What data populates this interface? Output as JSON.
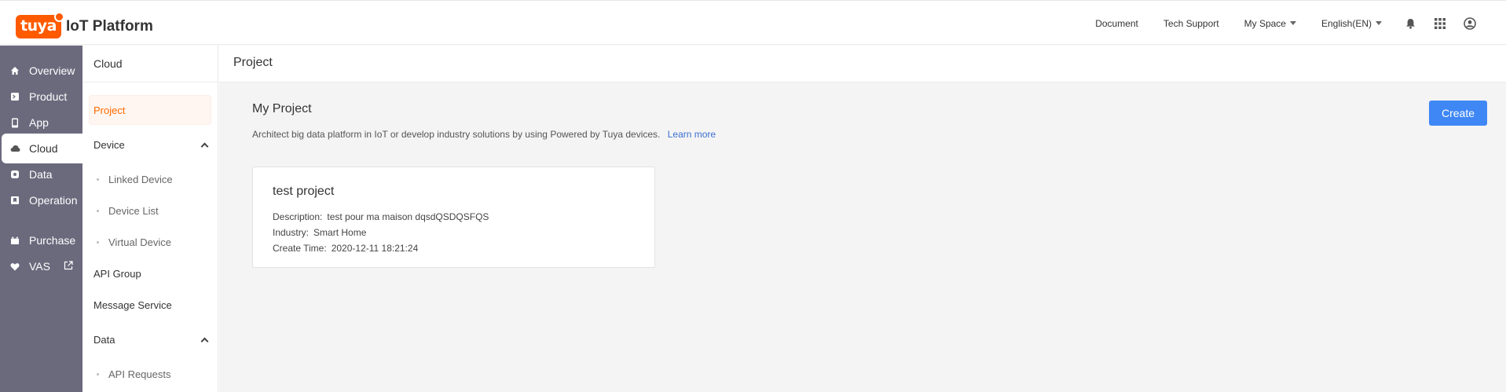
{
  "header": {
    "logo_text": "tuya",
    "platform_title": "IoT Platform",
    "nav": {
      "document": "Document",
      "tech_support": "Tech Support",
      "my_space": "My Space",
      "language": "English(EN)"
    },
    "icons": [
      "bell-icon",
      "apps-grid-icon",
      "user-account-icon"
    ]
  },
  "rail": {
    "items": [
      {
        "label": "Overview",
        "icon": "home-icon"
      },
      {
        "label": "Product",
        "icon": "product-icon"
      },
      {
        "label": "App",
        "icon": "phone-icon"
      },
      {
        "label": "Cloud",
        "icon": "cloud-icon",
        "active": true
      },
      {
        "label": "Data",
        "icon": "data-icon"
      },
      {
        "label": "Operation",
        "icon": "operation-icon"
      },
      {
        "label": "Purchase",
        "icon": "purchase-icon"
      },
      {
        "label": "VAS",
        "icon": "heart-icon"
      }
    ]
  },
  "subnav": {
    "title": "Cloud",
    "items": {
      "project": "Project",
      "device_group": "Device",
      "linked_device": "Linked Device",
      "device_list": "Device List",
      "virtual_device": "Virtual Device",
      "api_group": "API Group",
      "message_service": "Message Service",
      "data_group": "Data",
      "api_requests": "API Requests"
    }
  },
  "main": {
    "page_title": "Project",
    "section_title": "My Project",
    "description": "Architect big data platform in IoT or develop industry solutions by using Powered by Tuya devices.",
    "learn_more": "Learn more",
    "create_button": "Create",
    "project_card": {
      "name": "test project",
      "description_label": "Description:",
      "description_value": "test pour ma maison dqsdQSDQSFQS",
      "industry_label": "Industry:",
      "industry_value": "Smart Home",
      "create_time_label": "Create Time:",
      "create_time_value": "2020-12-11 18:21:24"
    }
  },
  "colors": {
    "brand": "#ff5a00",
    "rail_bg": "#6b6a7d",
    "primary_button": "#3f87f5",
    "active_subnav": "#ff6a00",
    "link": "#3c6fd1"
  }
}
